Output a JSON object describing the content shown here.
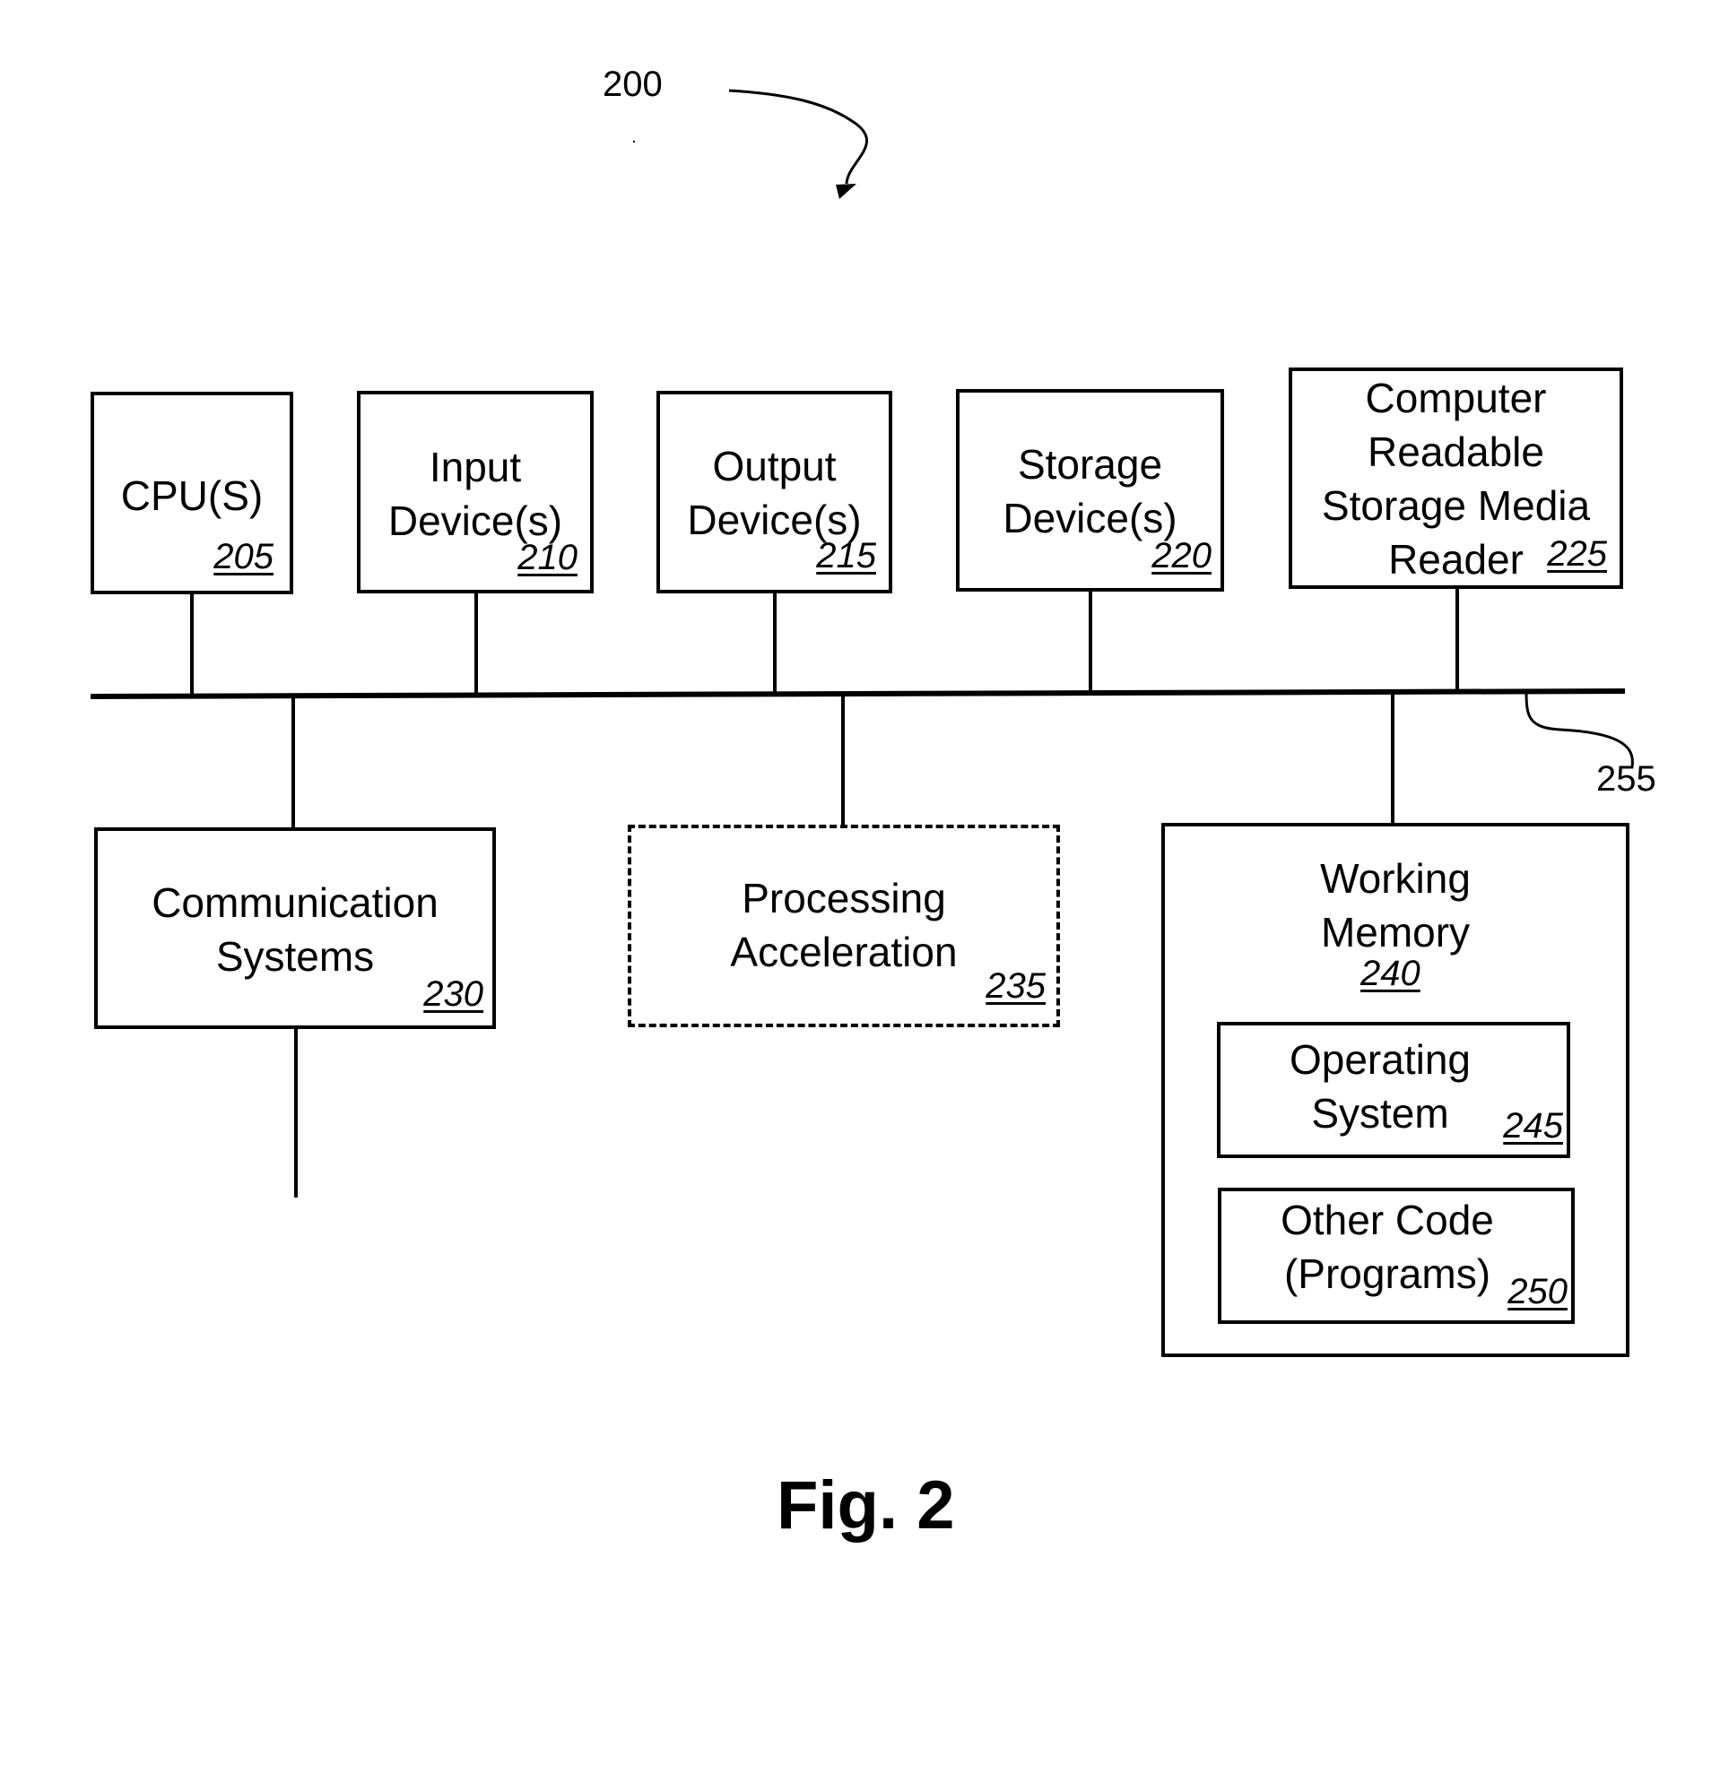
{
  "figure": {
    "system_ref": "200",
    "bus_ref": "255",
    "caption": "Fig. 2"
  },
  "components": {
    "cpu": {
      "label": "CPU(S)",
      "ref": "205"
    },
    "input": {
      "label": "Input\nDevice(s)",
      "ref": "210"
    },
    "output": {
      "label": "Output\nDevice(s)",
      "ref": "215"
    },
    "storage": {
      "label": "Storage\nDevice(s)",
      "ref": "220"
    },
    "crsm_reader": {
      "label": "Computer\nReadable\nStorage Media\n     Reader",
      "ref": "225"
    },
    "communication": {
      "label": "Communication\nSystems",
      "ref": "230"
    },
    "processing_acceleration": {
      "label": "Processing\nAcceleration",
      "ref": "235",
      "optional": true
    },
    "working_memory": {
      "label": "Working\nMemory",
      "ref": "240"
    },
    "operating_system": {
      "label": "Operating\nSystem",
      "ref": "245"
    },
    "other_code": {
      "label": "Other Code\n(Programs)",
      "ref": "250"
    }
  }
}
